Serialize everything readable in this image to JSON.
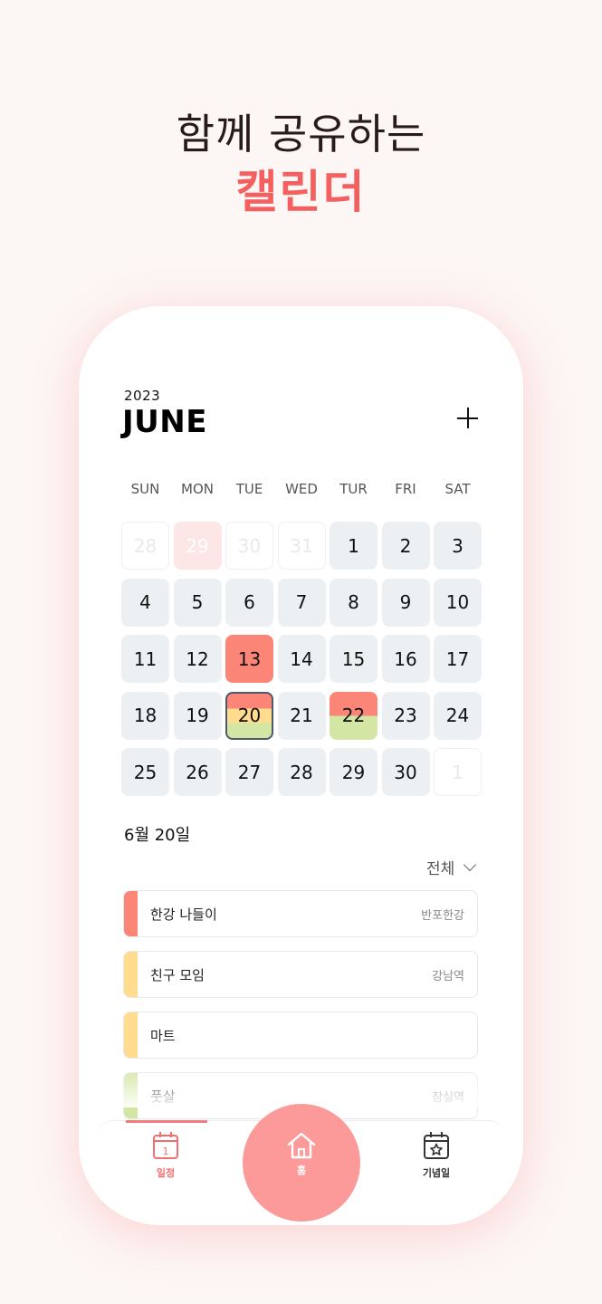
{
  "headline": {
    "line1": "함께 공유하는",
    "line2": "캘린더"
  },
  "calendar": {
    "year": "2023",
    "month": "JUNE",
    "weekdays": [
      "SUN",
      "MON",
      "TUE",
      "WED",
      "TUR",
      "FRI",
      "SAT"
    ],
    "days": [
      {
        "label": "28",
        "state": "out"
      },
      {
        "label": "29",
        "state": "out-pink"
      },
      {
        "label": "30",
        "state": "out"
      },
      {
        "label": "31",
        "state": "out"
      },
      {
        "label": "1"
      },
      {
        "label": "2"
      },
      {
        "label": "3"
      },
      {
        "label": "4"
      },
      {
        "label": "5"
      },
      {
        "label": "6"
      },
      {
        "label": "7"
      },
      {
        "label": "8"
      },
      {
        "label": "9"
      },
      {
        "label": "10"
      },
      {
        "label": "11"
      },
      {
        "label": "12"
      },
      {
        "label": "13",
        "state": "red"
      },
      {
        "label": "14"
      },
      {
        "label": "15"
      },
      {
        "label": "16"
      },
      {
        "label": "17"
      },
      {
        "label": "18"
      },
      {
        "label": "19"
      },
      {
        "label": "20",
        "state": "selected",
        "stripes": [
          "#fb8577",
          "#ffdc8e",
          "#d4e6a4"
        ]
      },
      {
        "label": "21"
      },
      {
        "label": "22",
        "stripes": [
          "#fb8577",
          "#d4e6a4"
        ]
      },
      {
        "label": "23"
      },
      {
        "label": "24"
      },
      {
        "label": "25"
      },
      {
        "label": "26"
      },
      {
        "label": "27"
      },
      {
        "label": "28"
      },
      {
        "label": "29"
      },
      {
        "label": "30"
      },
      {
        "label": "1",
        "state": "out"
      }
    ]
  },
  "agenda": {
    "date_title": "6월 20일",
    "filter_label": "전체",
    "events": [
      {
        "name": "한강 나들이",
        "place": "반포한강",
        "color": "#fb8577"
      },
      {
        "name": "친구 모임",
        "place": "강남역",
        "color": "#ffdc8e"
      },
      {
        "name": "마트",
        "place": "",
        "color": "#ffdc8e"
      },
      {
        "name": "풋살",
        "place": "잠실역",
        "color": "#d4e6a4"
      }
    ]
  },
  "nav": {
    "schedule_label": "일정",
    "schedule_icon_number": "1",
    "home_label": "홈",
    "anniversary_label": "기념일",
    "active_color": "#f26f6f"
  }
}
